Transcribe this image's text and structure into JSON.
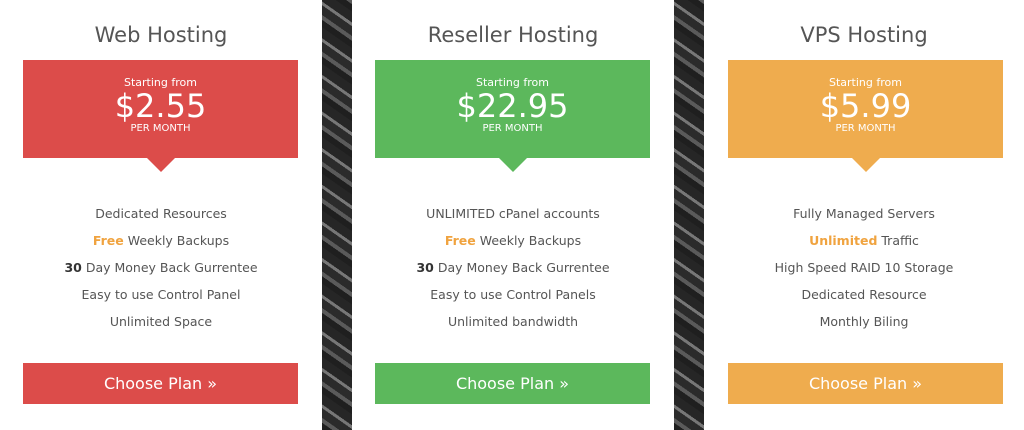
{
  "colors": {
    "red": "#dc4c4a",
    "green": "#5cb85c",
    "orange": "#efac4e"
  },
  "plans": [
    {
      "title": "Web Hosting",
      "starting_from": "Starting from",
      "price": "$2.55",
      "per": "PER MONTH",
      "features": [
        {
          "pre": "",
          "highlight": "",
          "bold": "",
          "text": "Dedicated Resources"
        },
        {
          "pre": "",
          "highlight": "Free",
          "bold": "",
          "text": " Weekly Backups"
        },
        {
          "pre": "",
          "highlight": "",
          "bold": "30",
          "text": " Day Money Back Gurrentee"
        },
        {
          "pre": "",
          "highlight": "",
          "bold": "",
          "text": "Easy to use Control Panel"
        },
        {
          "pre": "",
          "highlight": "",
          "bold": "",
          "text": "Unlimited Space"
        }
      ],
      "button": "Choose Plan »"
    },
    {
      "title": "Reseller Hosting",
      "starting_from": "Starting from",
      "price": "$22.95",
      "per": "PER MONTH",
      "features": [
        {
          "pre": "",
          "highlight": "",
          "bold": "",
          "text": "UNLIMITED cPanel accounts"
        },
        {
          "pre": "",
          "highlight": "Free",
          "bold": "",
          "text": " Weekly Backups"
        },
        {
          "pre": "",
          "highlight": "",
          "bold": "30",
          "text": " Day Money Back Gurrentee"
        },
        {
          "pre": "",
          "highlight": "",
          "bold": "",
          "text": "Easy to use Control Panels"
        },
        {
          "pre": "",
          "highlight": "",
          "bold": "",
          "text": "Unlimited bandwidth"
        }
      ],
      "button": "Choose Plan »"
    },
    {
      "title": "VPS Hosting",
      "starting_from": "Starting from",
      "price": "$5.99",
      "per": "PER MONTH",
      "features": [
        {
          "pre": "",
          "highlight": "",
          "bold": "",
          "text": "Fully Managed Servers"
        },
        {
          "pre": "",
          "highlight": "Unlimited",
          "bold": "",
          "text": " Traffic"
        },
        {
          "pre": "",
          "highlight": "",
          "bold": "",
          "text": "High Speed RAID 10 Storage"
        },
        {
          "pre": "",
          "highlight": "",
          "bold": "",
          "text": "Dedicated Resource"
        },
        {
          "pre": "",
          "highlight": "",
          "bold": "",
          "text": "Monthly Biling"
        }
      ],
      "button": "Choose Plan »"
    }
  ]
}
